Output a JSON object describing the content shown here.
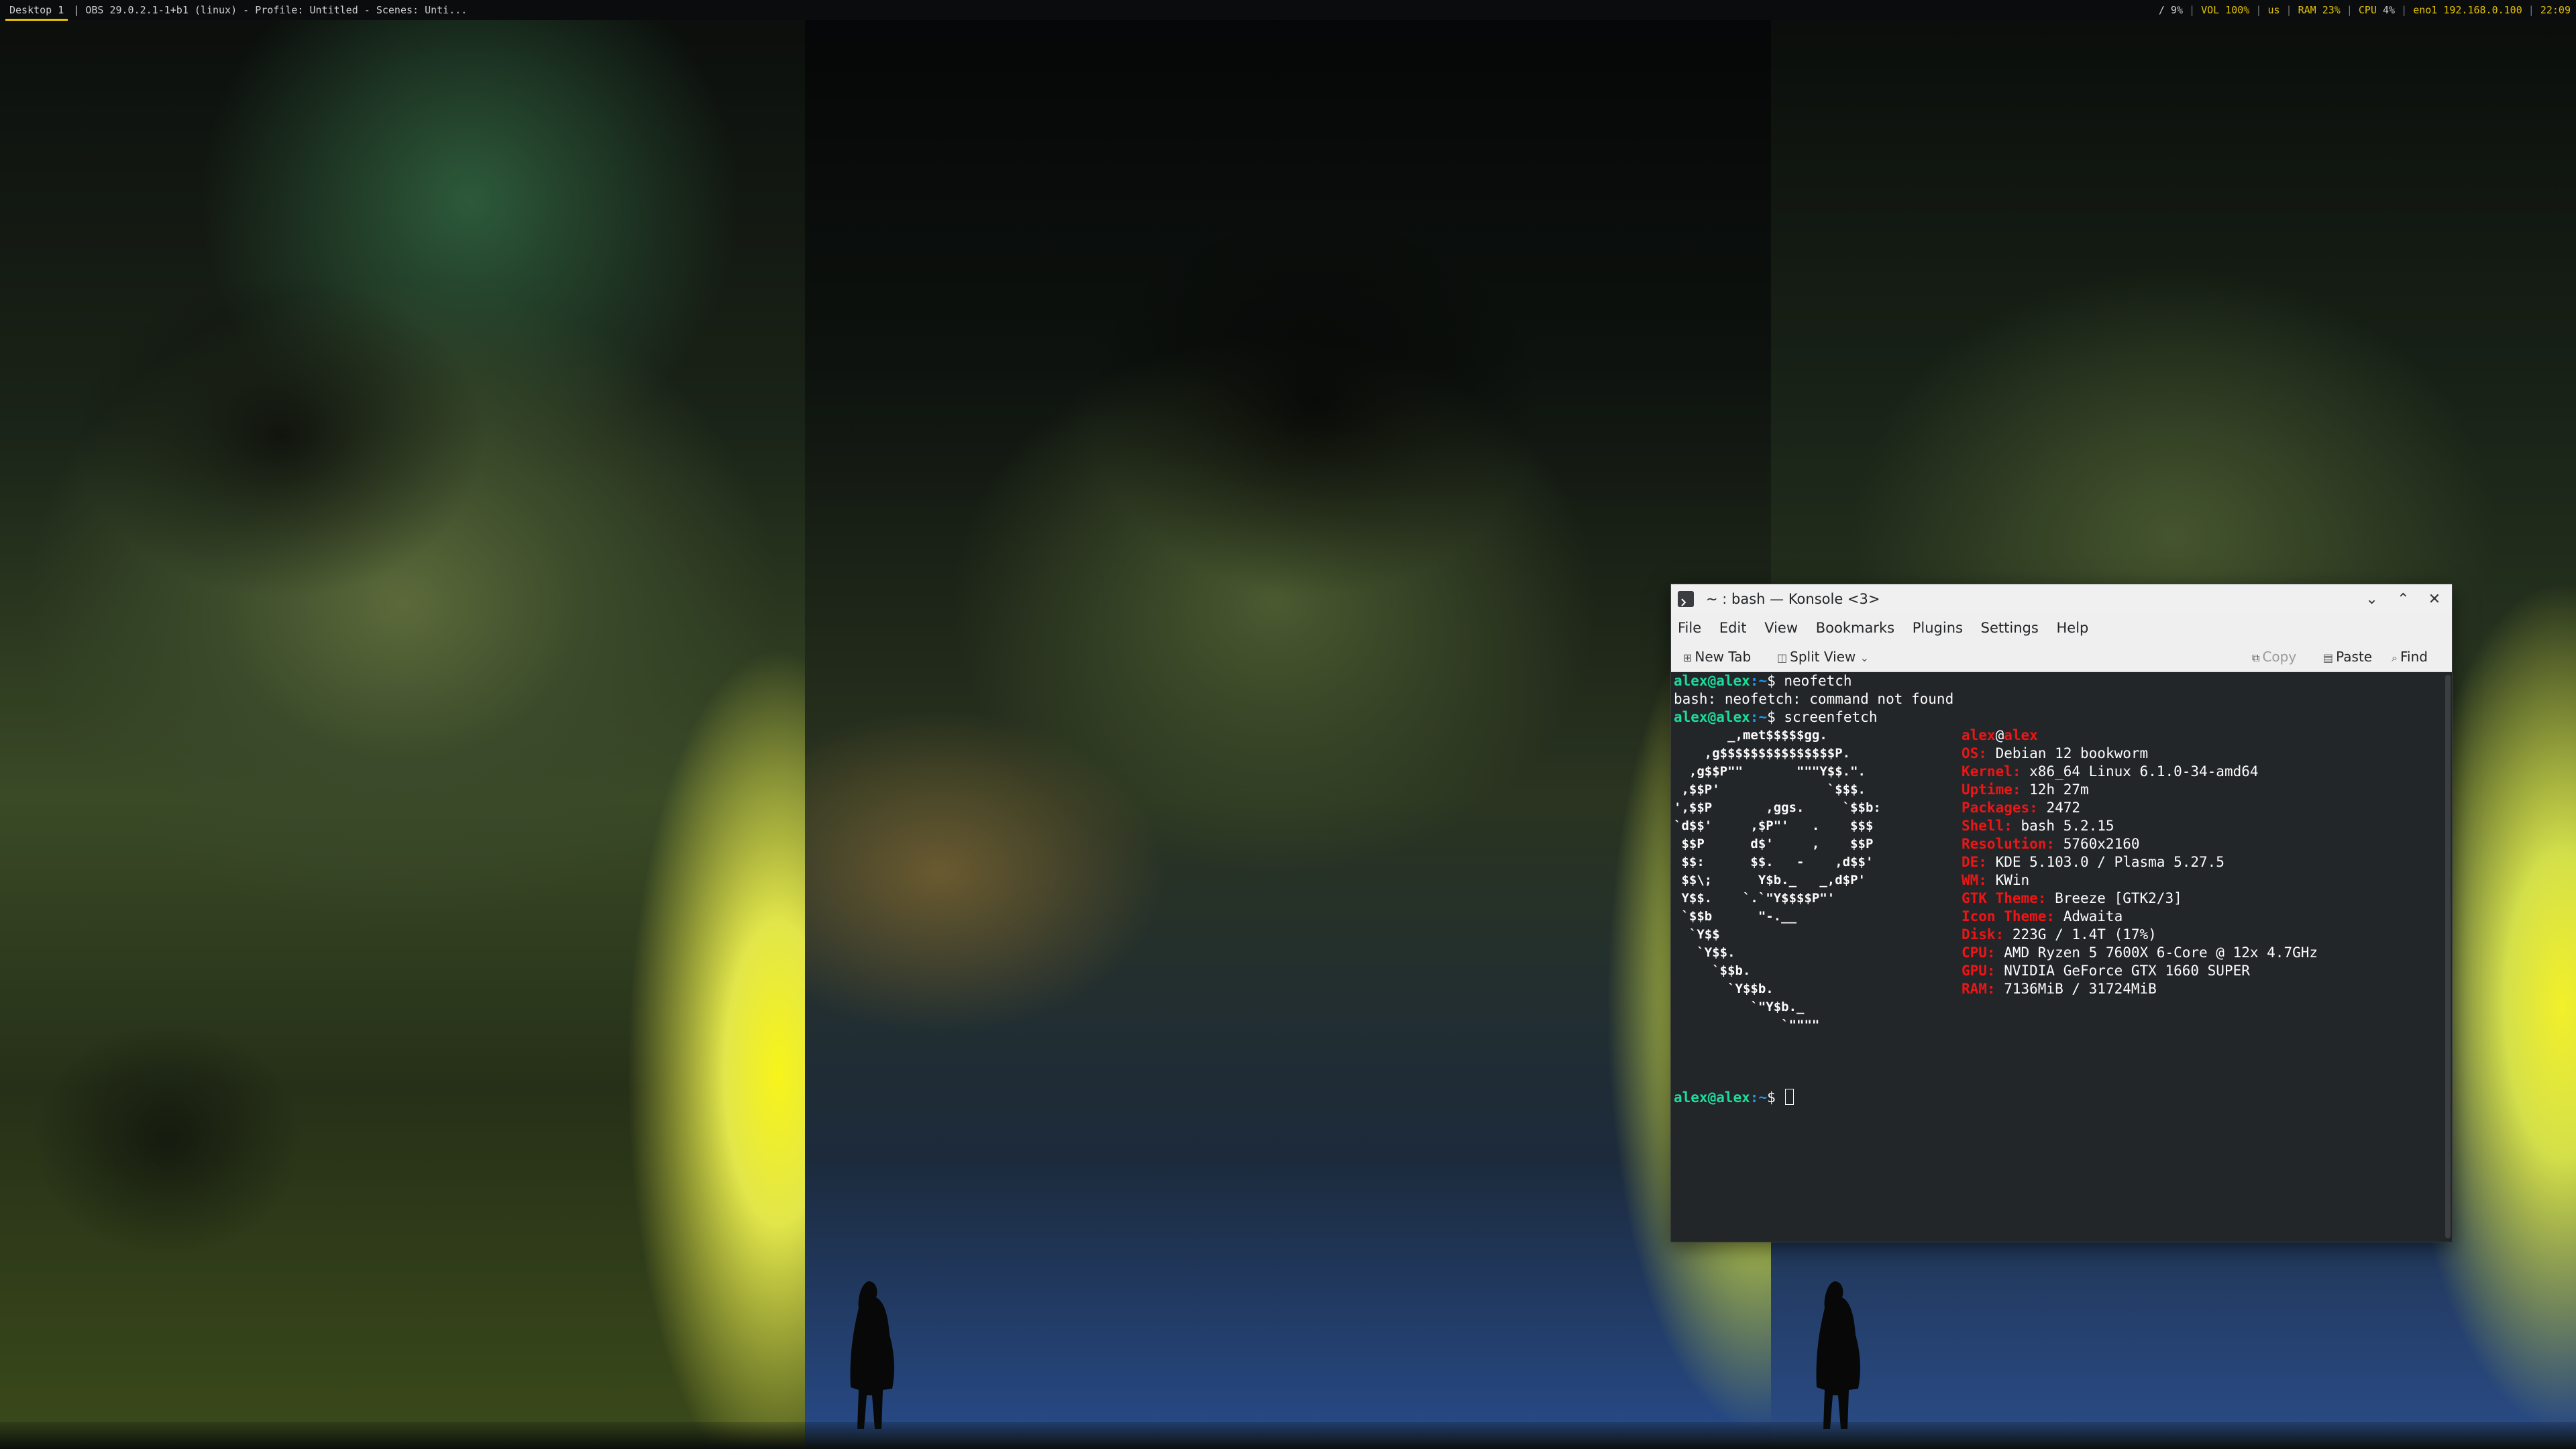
{
  "topbar": {
    "workspace": "Desktop 1",
    "window_title": "| OBS 29.0.2.1-1+b1 (linux) - Profile: Untitled - Scenes: Unti...",
    "disk": "/ 9%",
    "volume": "VOL 100%",
    "layout": "us",
    "ram": "RAM 23%",
    "cpu_label": "CPU",
    "cpu": "4%",
    "net": "eno1 192.168.0.100",
    "time": "22:09"
  },
  "konsole": {
    "title": "~ : bash — Konsole <3>",
    "window_buttons": {
      "minimize": "⌄",
      "maximize": "⌃",
      "close": "✕"
    },
    "menu": [
      "File",
      "Edit",
      "View",
      "Bookmarks",
      "Plugins",
      "Settings",
      "Help"
    ],
    "toolbar": {
      "new_tab": "New Tab",
      "split_view": "Split View",
      "copy": "Copy",
      "paste": "Paste",
      "find": "Find"
    },
    "terminal": {
      "prompt_user": "alex@alex",
      "prompt_path": ":~",
      "prompt_sign": "$ ",
      "cmd1": "neofetch",
      "err1": "bash: neofetch: command not found",
      "cmd2": "screenfetch",
      "art": [
        "       _,met$$$$$gg.",
        "    ,g$$$$$$$$$$$$$$$P.",
        "  ,g$$P\"\"       \"\"\"Y$$.\".",
        " ,$$P'              `$$$.",
        "',$$P       ,ggs.     `$$b:",
        "`d$$'     ,$P\"'   .    $$$",
        " $$P      d$'     ,    $$P",
        " $$:      $$.   -    ,d$$'",
        " $$\\;      Y$b._   _,d$P'",
        " Y$$.    `.`\"Y$$$$P\"'",
        " `$$b      \"-.__",
        "  `Y$$",
        "   `Y$$.",
        "     `$$b.",
        "       `Y$$b.",
        "          `\"Y$b._",
        "              `\"\"\"\""
      ],
      "host_user": "alex",
      "host_at": "@",
      "host_name": "alex",
      "info": [
        {
          "label": "OS:",
          "value": " Debian 12 bookworm"
        },
        {
          "label": "Kernel:",
          "value": " x86_64 Linux 6.1.0-34-amd64"
        },
        {
          "label": "Uptime:",
          "value": " 12h 27m"
        },
        {
          "label": "Packages:",
          "value": " 2472"
        },
        {
          "label": "Shell:",
          "value": " bash 5.2.15"
        },
        {
          "label": "Resolution:",
          "value": " 5760x2160"
        },
        {
          "label": "DE:",
          "value": " KDE 5.103.0 / Plasma 5.27.5"
        },
        {
          "label": "WM:",
          "value": " KWin"
        },
        {
          "label": "GTK Theme:",
          "value": " Breeze [GTK2/3]"
        },
        {
          "label": "Icon Theme:",
          "value": " Adwaita"
        },
        {
          "label": "Disk:",
          "value": " 223G / 1.4T (17%)"
        },
        {
          "label": "CPU:",
          "value": " AMD Ryzen 5 7600X 6-Core @ 12x 4.7GHz"
        },
        {
          "label": "GPU:",
          "value": " NVIDIA GeForce GTX 1660 SUPER"
        },
        {
          "label": "RAM:",
          "value": " 7136MiB / 31724MiB"
        }
      ]
    }
  },
  "icons": {
    "app": "terminal-icon",
    "new_tab": "new-tab-icon",
    "split_view": "split-view-icon",
    "copy": "copy-icon",
    "paste": "paste-icon",
    "find": "search-icon"
  },
  "colors": {
    "terminal_bg": "#232629",
    "prompt_green": "#1cdc9a",
    "prompt_blue": "#1d99f3",
    "debian_red": "#ed1515",
    "workspace_accent": "#e6c200"
  }
}
